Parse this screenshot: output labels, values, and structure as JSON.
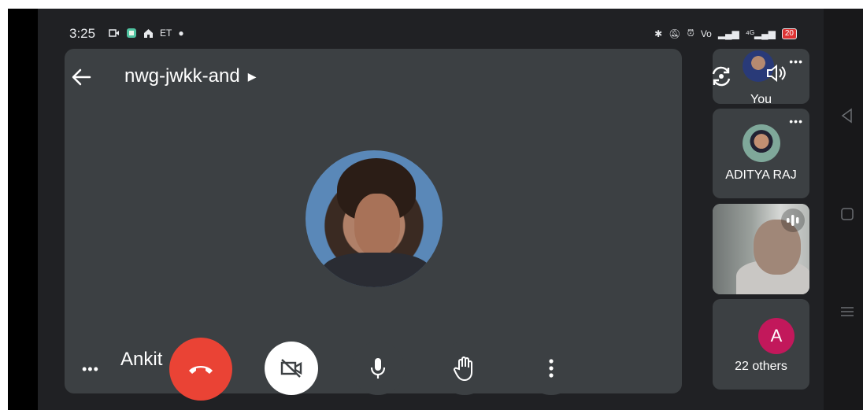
{
  "status_bar": {
    "time": "3:25",
    "left_icons": [
      "video-call-icon",
      "app-icon",
      "home-icon",
      "et-icon",
      "dot-icon"
    ],
    "et_text": "ET",
    "right_icons": [
      "bluetooth-icon",
      "mute-icon",
      "alarm-icon",
      "volte-icon",
      "signal-icon",
      "signal-4g-icon",
      "battery-icon"
    ],
    "battery": "20"
  },
  "meeting": {
    "code": "nwg-jwkk-and",
    "main_speaker": "Ankit"
  },
  "participants": {
    "you_label": "You",
    "aditya_label": "ADITYA RAJ",
    "others_avatar_letter": "A",
    "others_label": "22 others"
  },
  "controls": {
    "end_call": "end-call-icon",
    "camera": "camera-off-icon",
    "mic": "mic-icon",
    "hand": "raise-hand-icon",
    "more": "more-options-icon"
  },
  "colors": {
    "end_call": "#ea4335",
    "tile_bg": "#3c4043",
    "screen_bg": "#202124",
    "others_avatar": "#c2185b"
  }
}
